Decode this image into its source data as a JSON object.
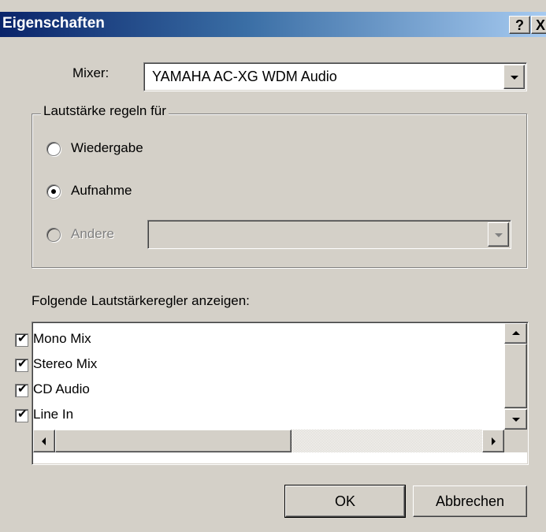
{
  "window": {
    "title": "Eigenschaften",
    "help_button": "?",
    "close_button": "X",
    "accent_color": "#0a246a",
    "face_color": "#d4d0c8"
  },
  "mixer": {
    "label": "Mixer:",
    "value": "YAMAHA AC-XG WDM Audio"
  },
  "volume_group": {
    "legend": "Lautstärke regeln für",
    "options": [
      {
        "label": "Wiedergabe",
        "selected": false,
        "enabled": true
      },
      {
        "label": "Aufnahme",
        "selected": true,
        "enabled": true
      },
      {
        "label": "Andere",
        "selected": false,
        "enabled": false
      }
    ],
    "other_value": ""
  },
  "controls_list": {
    "caption": "Folgende Lautstärkeregler anzeigen:",
    "items": [
      {
        "label": "Mono Mix",
        "checked": true
      },
      {
        "label": "Stereo Mix",
        "checked": true
      },
      {
        "label": "CD Audio",
        "checked": true
      },
      {
        "label": "Line In",
        "checked": true
      }
    ]
  },
  "buttons": {
    "ok": "OK",
    "cancel": "Abbrechen"
  },
  "icons": {
    "check": "✔",
    "scroll": [
      "arrow-up-icon",
      "arrow-down-icon",
      "arrow-left-icon",
      "arrow-right-icon"
    ]
  }
}
